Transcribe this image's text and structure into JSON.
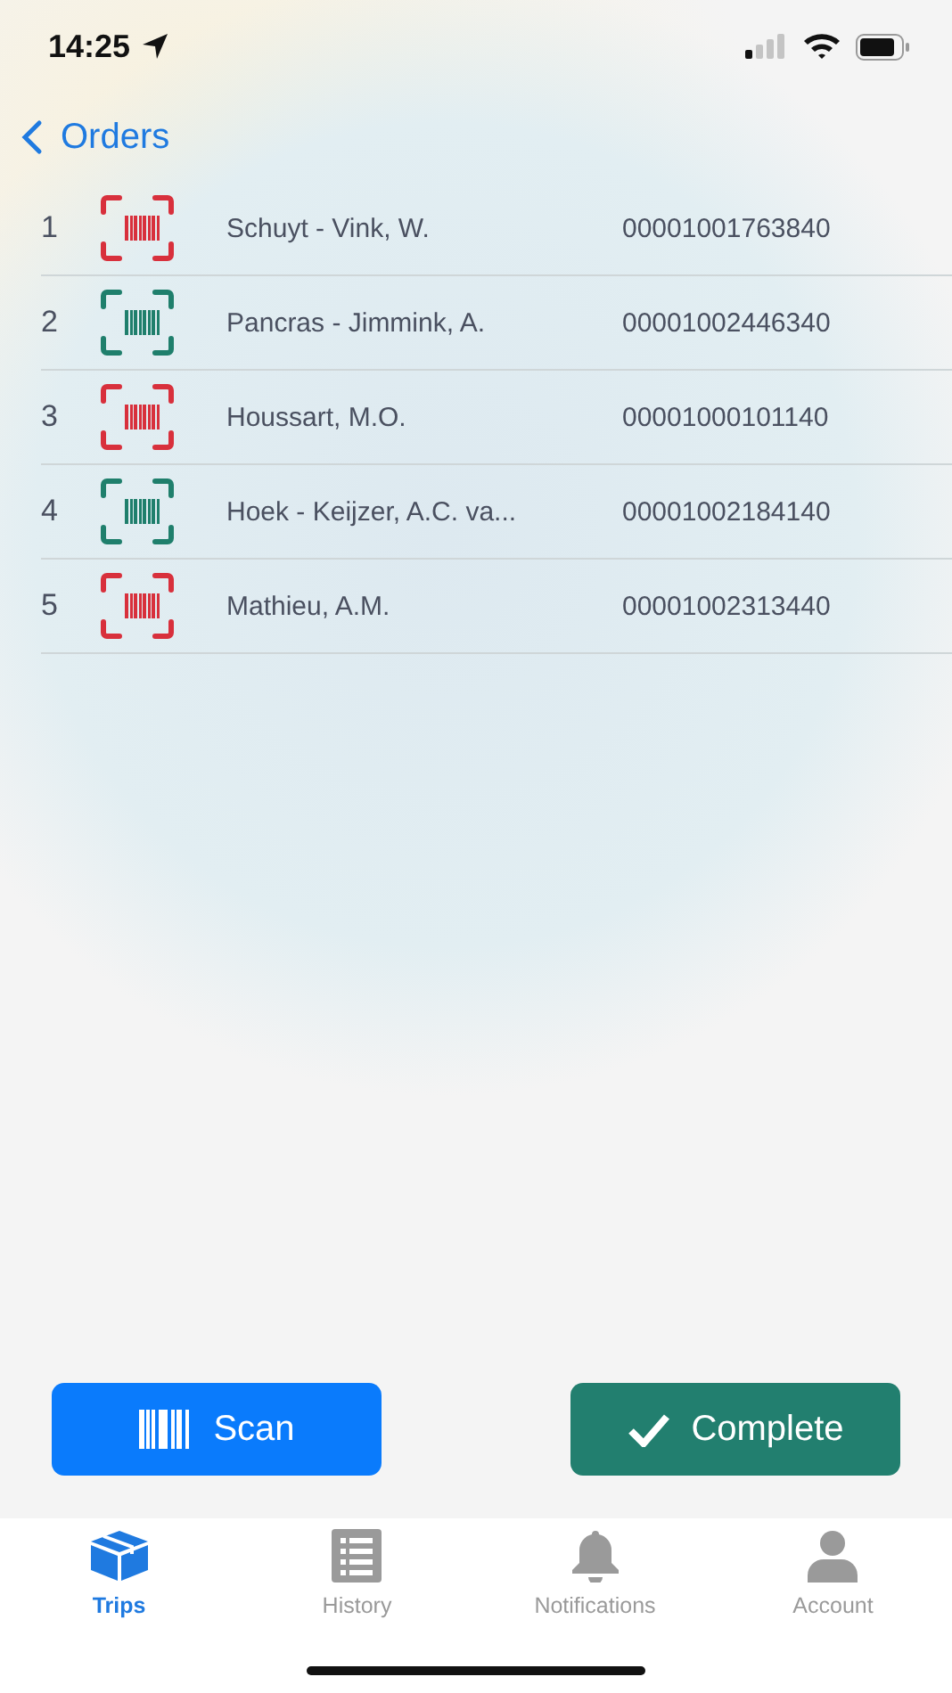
{
  "status_bar": {
    "time": "14:25"
  },
  "nav": {
    "back_label": "Orders"
  },
  "orders": [
    {
      "index": "1",
      "name": "Schuyt - Vink, W.",
      "number": "00001001763840",
      "scanned": false
    },
    {
      "index": "2",
      "name": "Pancras - Jimmink, A.",
      "number": "00001002446340",
      "scanned": true
    },
    {
      "index": "3",
      "name": "Houssart, M.O.",
      "number": "00001000101140",
      "scanned": false
    },
    {
      "index": "4",
      "name": "Hoek - Keijzer, A.C. va...",
      "number": "00001002184140",
      "scanned": true
    },
    {
      "index": "5",
      "name": "Mathieu, A.M.",
      "number": "00001002313440",
      "scanned": false
    }
  ],
  "actions": [
    {
      "kind": "scan",
      "label": "Scan"
    },
    {
      "kind": "complete",
      "label": "Complete"
    }
  ],
  "tabs": [
    {
      "kind": "trips",
      "label": "Trips",
      "selected": true
    },
    {
      "kind": "history",
      "label": "History",
      "selected": false
    },
    {
      "kind": "notifications",
      "label": "Notifications",
      "selected": false
    },
    {
      "kind": "account",
      "label": "Account",
      "selected": false
    }
  ]
}
